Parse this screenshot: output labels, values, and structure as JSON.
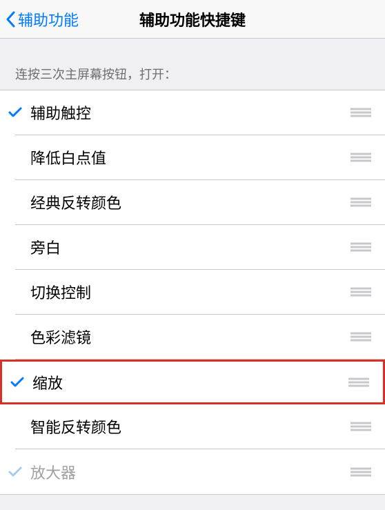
{
  "navbar": {
    "back_label": "辅助功能",
    "title": "辅助功能快捷键"
  },
  "section": {
    "header": "连按三次主屏幕按钮，打开："
  },
  "items": [
    {
      "label": "辅助触控",
      "checked": true,
      "highlighted": false,
      "muted": false
    },
    {
      "label": "降低白点值",
      "checked": false,
      "highlighted": false,
      "muted": false
    },
    {
      "label": "经典反转颜色",
      "checked": false,
      "highlighted": false,
      "muted": false
    },
    {
      "label": "旁白",
      "checked": false,
      "highlighted": false,
      "muted": false
    },
    {
      "label": "切换控制",
      "checked": false,
      "highlighted": false,
      "muted": false
    },
    {
      "label": "色彩滤镜",
      "checked": false,
      "highlighted": false,
      "muted": false
    },
    {
      "label": "缩放",
      "checked": true,
      "highlighted": true,
      "muted": false
    },
    {
      "label": "智能反转颜色",
      "checked": false,
      "highlighted": false,
      "muted": false
    },
    {
      "label": "放大器",
      "checked": true,
      "highlighted": false,
      "muted": true
    }
  ]
}
